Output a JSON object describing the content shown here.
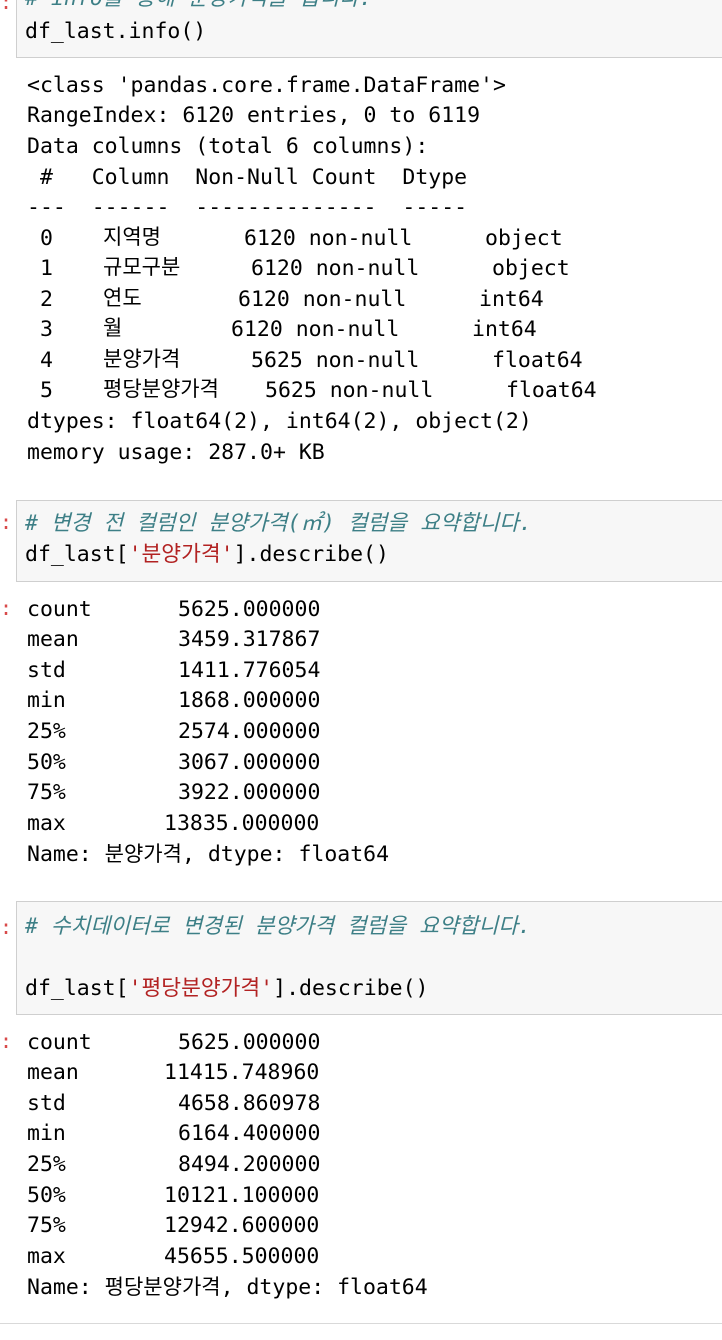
{
  "cell1": {
    "comment": "# info를 통해 분양가격을 봅니다.",
    "code": "df_last.info()"
  },
  "info_output": {
    "lines": [
      "<class 'pandas.core.frame.DataFrame'>",
      "RangeIndex: 6120 entries, 0 to 6119",
      "Data columns (total 6 columns):",
      " #   Column  Non-Null Count  Dtype",
      "---  ------  --------------  -----"
    ],
    "rows": [
      {
        "idx": "0",
        "name": "지역명",
        "count": "6120 non-null",
        "dtype": "object"
      },
      {
        "idx": "1",
        "name": "규모구분",
        "count": "6120 non-null",
        "dtype": "object"
      },
      {
        "idx": "2",
        "name": "연도",
        "count": "6120 non-null",
        "dtype": "int64"
      },
      {
        "idx": "3",
        "name": "월",
        "count": "6120 non-null",
        "dtype": "int64"
      },
      {
        "idx": "4",
        "name": "분양가격",
        "count": "5625 non-null",
        "dtype": "float64"
      },
      {
        "idx": "5",
        "name": "평당분양가격",
        "count": "5625 non-null",
        "dtype": "float64"
      }
    ],
    "dtypes_line": "dtypes: float64(2), int64(2), object(2)",
    "memory_line": "memory usage: 287.0+ KB"
  },
  "cell2": {
    "comment": "# 변경 전 컬럼인 분양가격(㎡) 컬럼을 요약합니다.",
    "code_prefix": "df_last[",
    "code_string": "'분양가격'",
    "code_suffix": "].describe()"
  },
  "describe1": {
    "rows": [
      {
        "label": "count",
        "value": "5625.000000"
      },
      {
        "label": "mean",
        "value": "3459.317867"
      },
      {
        "label": "std",
        "value": "1411.776054"
      },
      {
        "label": "min",
        "value": "1868.000000"
      },
      {
        "label": "25%",
        "value": "2574.000000"
      },
      {
        "label": "50%",
        "value": "3067.000000"
      },
      {
        "label": "75%",
        "value": "3922.000000"
      },
      {
        "label": "max",
        "value": "13835.000000"
      }
    ],
    "name_prefix": "Name: ",
    "name_value": "분양가격",
    "name_suffix": ", dtype: float64"
  },
  "cell3": {
    "comment": "# 수치데이터로 변경된 분양가격 컬럼을 요약합니다.",
    "code_prefix": "df_last[",
    "code_string": "'평당분양가격'",
    "code_suffix": "].describe()"
  },
  "describe2": {
    "rows": [
      {
        "label": "count",
        "value": "5625.000000"
      },
      {
        "label": "mean",
        "value": "11415.748960"
      },
      {
        "label": "std",
        "value": "4658.860978"
      },
      {
        "label": "min",
        "value": "6164.400000"
      },
      {
        "label": "25%",
        "value": "8494.200000"
      },
      {
        "label": "50%",
        "value": "10121.100000"
      },
      {
        "label": "75%",
        "value": "12942.600000"
      },
      {
        "label": "max",
        "value": "45655.500000"
      }
    ],
    "name_prefix": "Name: ",
    "name_value": "평당분양가격",
    "name_suffix": ", dtype: float64"
  }
}
